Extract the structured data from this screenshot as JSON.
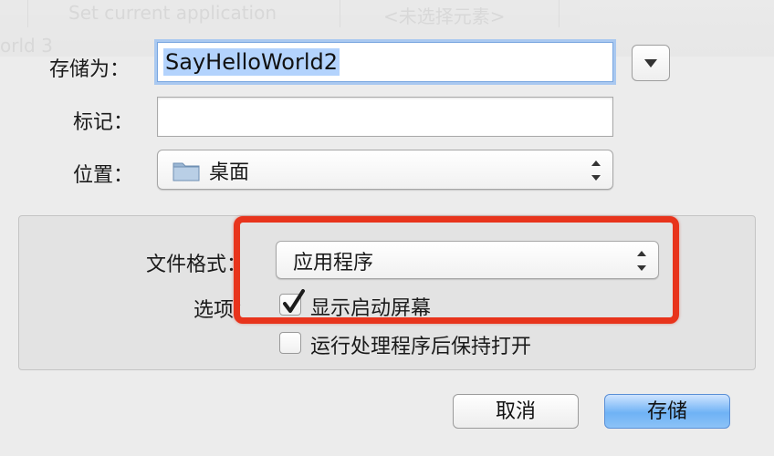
{
  "background_window": {
    "text_1": "Set current application",
    "text_2": "<未选择元素>",
    "text_3": "orld 3"
  },
  "dialog": {
    "save_as_label": "存储为：",
    "save_as_value": "SayHelloWorld2",
    "tags_label": "标记：",
    "tags_value": "",
    "location_label": "位置：",
    "location_value": "桌面",
    "location_icon": "folder-icon",
    "format_label": "文件格式：",
    "format_value": "应用程序",
    "options_label": "选项：",
    "option_1_label": "显示启动屏幕",
    "option_1_checked": true,
    "option_2_label": "运行处理程序后保持打开",
    "option_2_checked": false,
    "cancel_label": "取消",
    "save_label": "存储"
  },
  "colors": {
    "highlight": "#e8341c",
    "primary_button": "#6fb2f5",
    "selection": "#b3d3fd"
  }
}
